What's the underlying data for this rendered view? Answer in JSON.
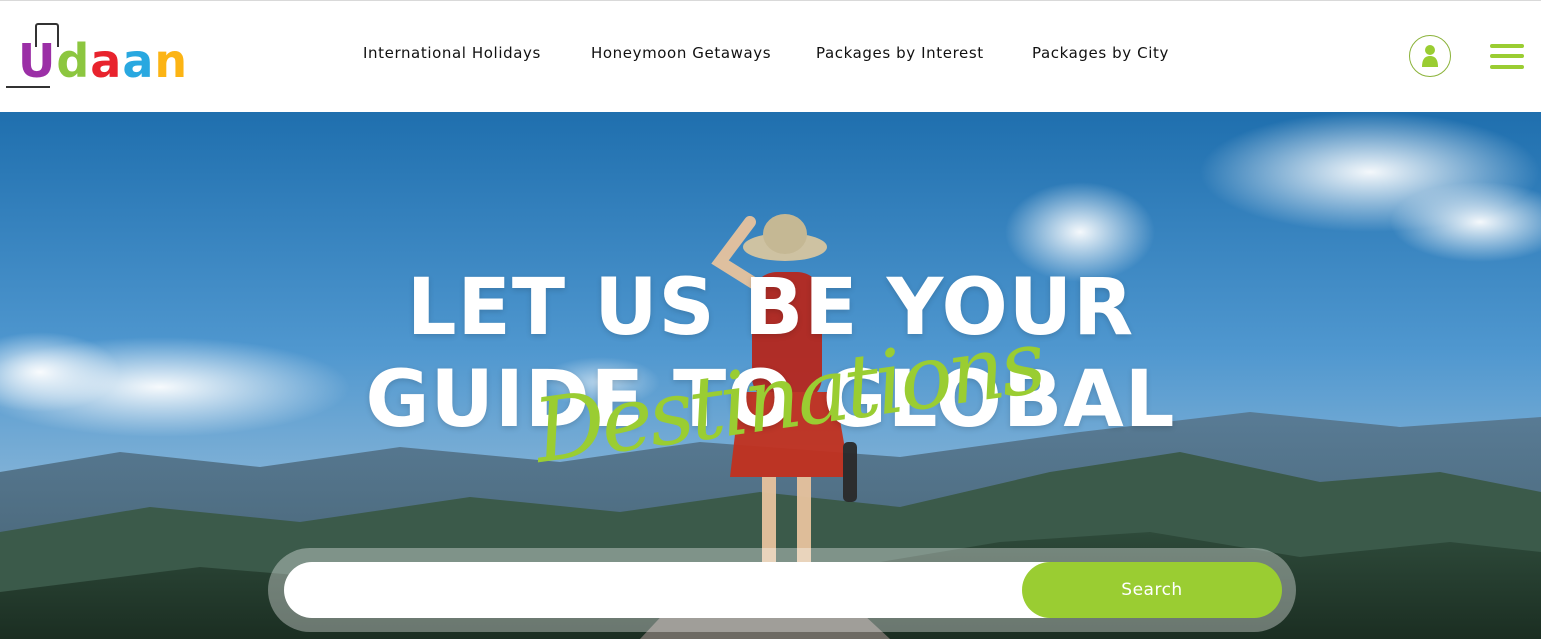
{
  "logo": {
    "letters": [
      "U",
      "d",
      "a",
      "a",
      "n"
    ],
    "colors": [
      "#9b2fa6",
      "#8cc63f",
      "#e8232d",
      "#29a8e0",
      "#fcb414"
    ]
  },
  "nav": {
    "items": [
      {
        "label": "International Holidays"
      },
      {
        "label": "Honeymoon Getaways"
      },
      {
        "label": "Packages by Interest"
      },
      {
        "label": "Packages by City"
      }
    ]
  },
  "header_actions": {
    "user_icon": "user-icon",
    "menu_icon": "hamburger-menu-icon"
  },
  "hero": {
    "headline_line1": "LET US BE YOUR",
    "headline_line2": "GUIDE TO GLOBAL",
    "script_word": "Destinations"
  },
  "search": {
    "value": "",
    "placeholder": "",
    "button_label": "Search"
  },
  "colors": {
    "accent": "#9acd32",
    "text": "#111111",
    "white": "#ffffff"
  }
}
